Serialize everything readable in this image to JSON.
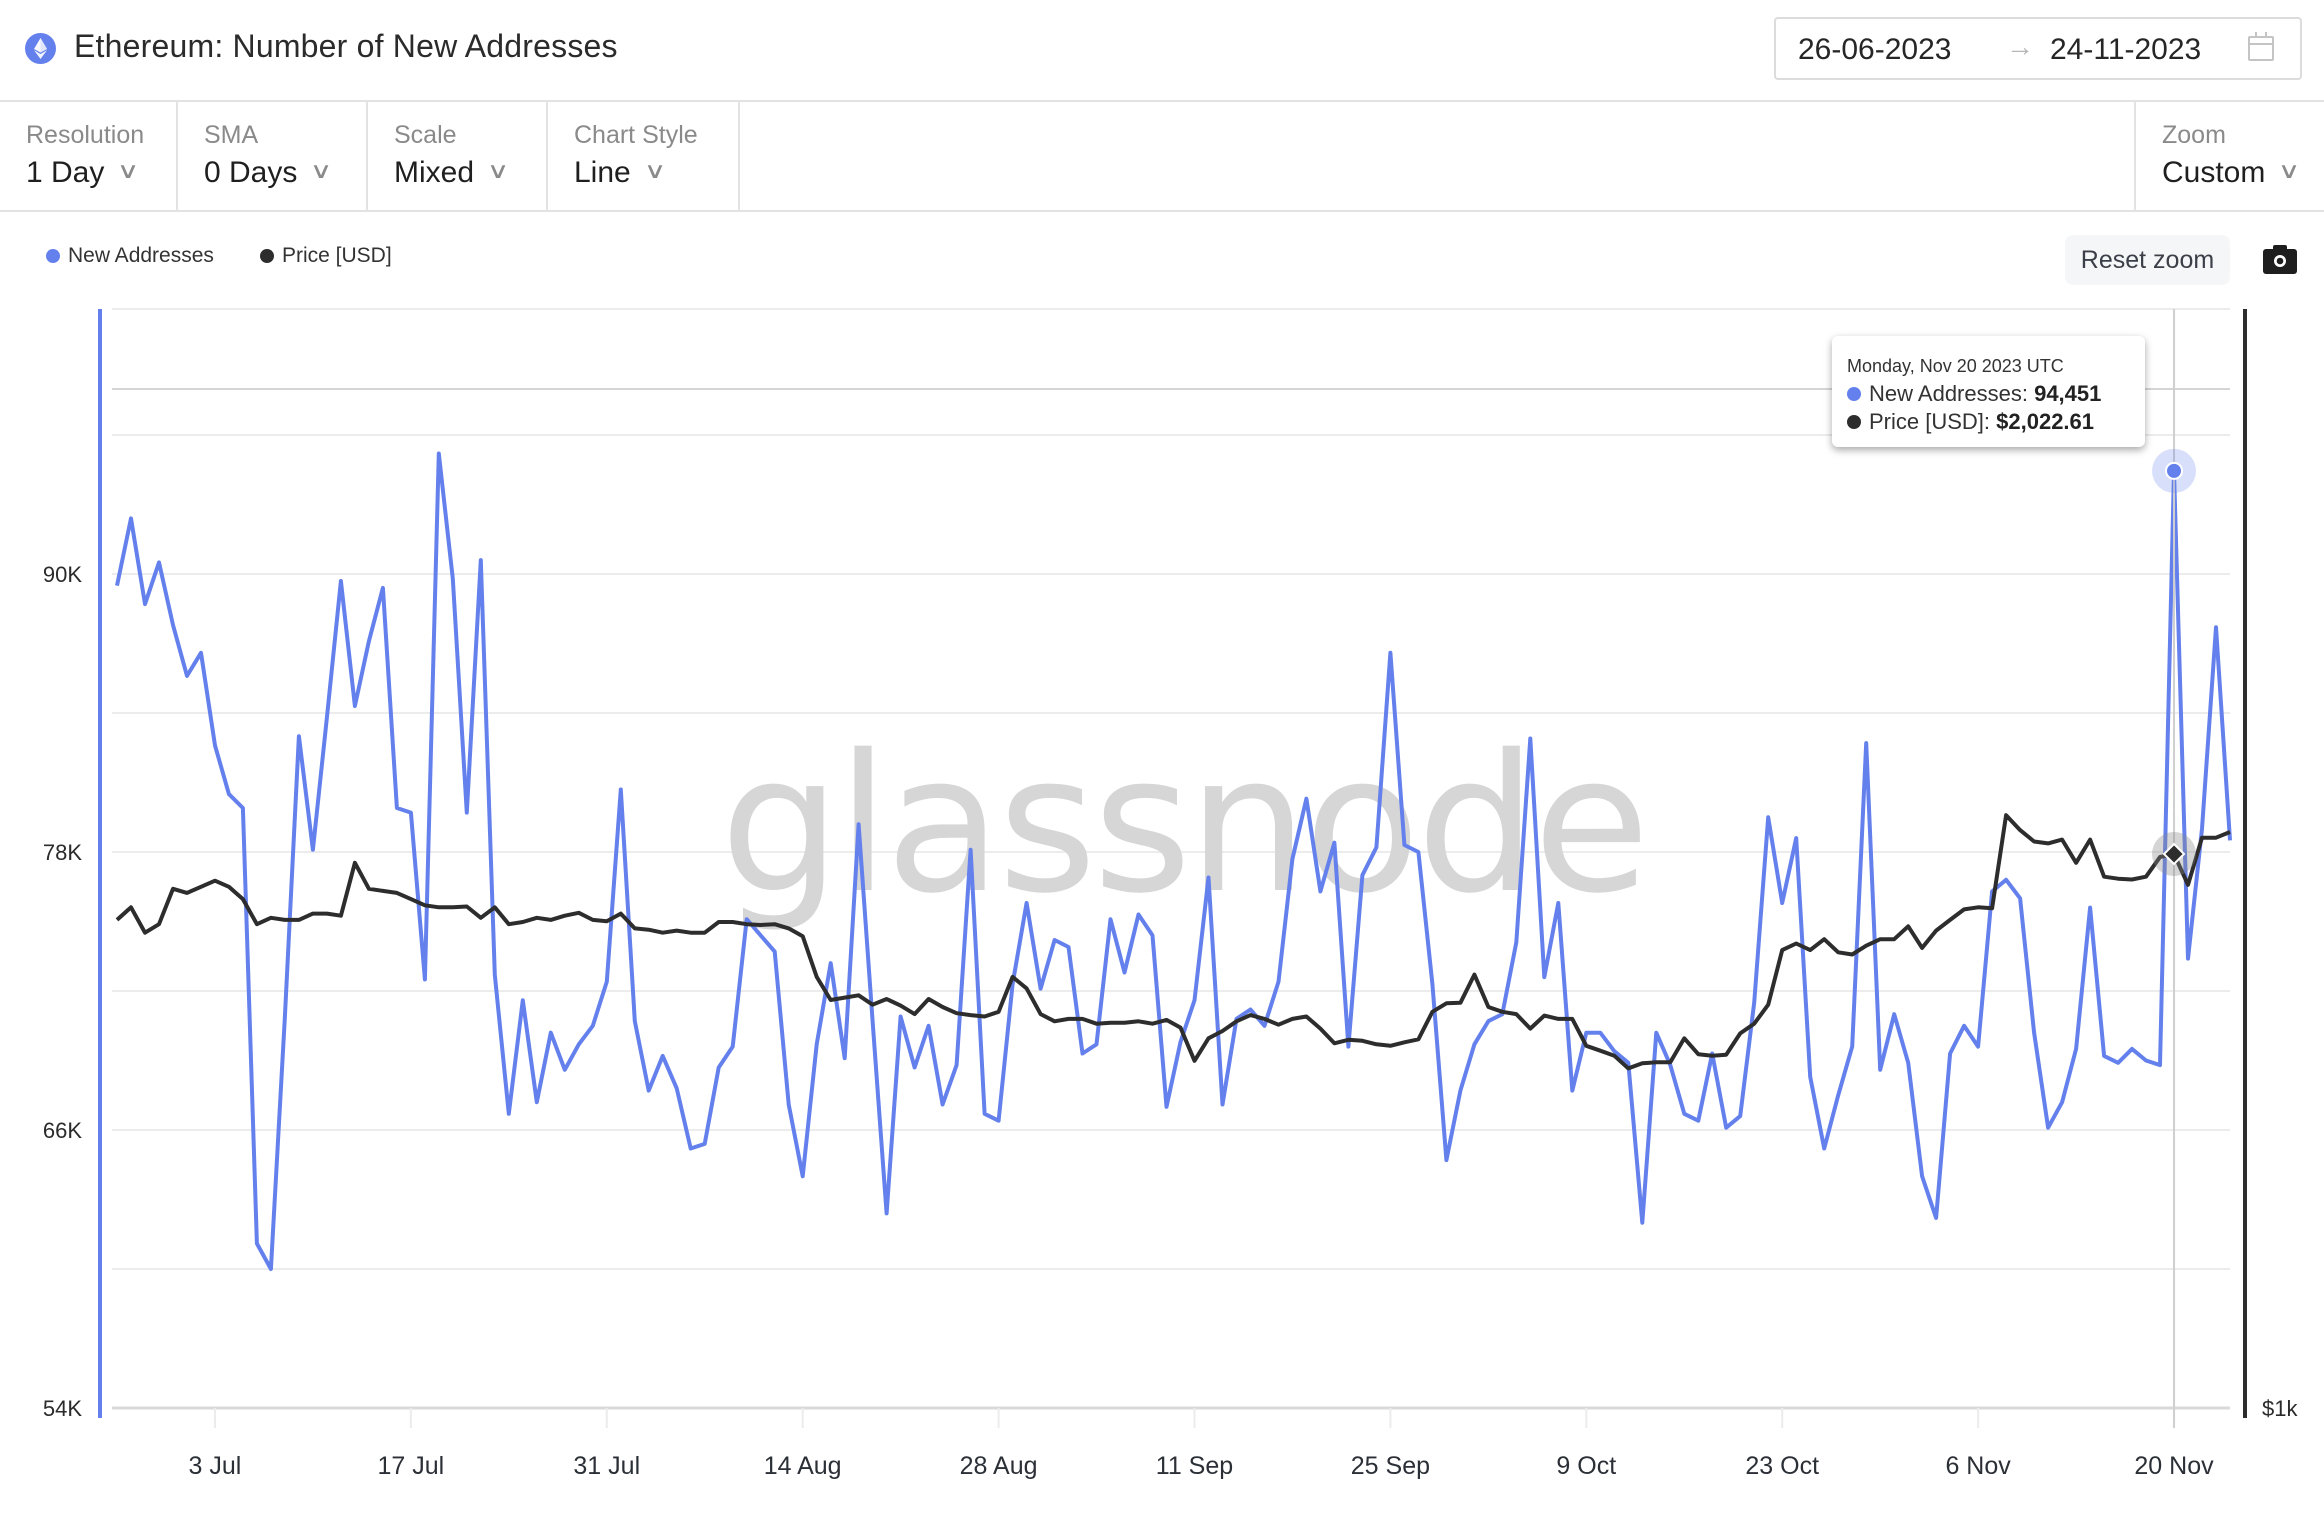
{
  "header": {
    "title": "Ethereum: Number of New Addresses",
    "asset_icon": "ethereum-icon",
    "date_start": "26-06-2023",
    "date_arrow": "→",
    "date_end": "24-11-2023",
    "calendar_icon": "calendar-icon"
  },
  "toolbar": {
    "resolution": {
      "label": "Resolution",
      "value": "1 Day"
    },
    "sma": {
      "label": "SMA",
      "value": "0 Days"
    },
    "scale": {
      "label": "Scale",
      "value": "Mixed"
    },
    "chart_style": {
      "label": "Chart Style",
      "value": "Line"
    },
    "zoom": {
      "label": "Zoom",
      "value": "Custom"
    },
    "chevron": "∨"
  },
  "controls": {
    "reset_zoom_label": "Reset zoom",
    "screenshot_icon": "camera-icon"
  },
  "colors": {
    "new_addresses": "#6480ec",
    "price": "#2d2d2d",
    "grid": "#ececec",
    "watermark": "#d6d6d6"
  },
  "watermark": "glassnode",
  "tooltip": {
    "date": "Monday, Nov 20 2023 UTC",
    "rows": [
      {
        "label": "New Addresses: ",
        "value": "94,451"
      },
      {
        "label": "Price [USD]: ",
        "value": "$2,022.61"
      }
    ]
  },
  "chart_data": {
    "type": "line",
    "title": "Ethereum: Number of New Addresses",
    "x_start": "2023-06-26",
    "x_end": "2023-11-24",
    "x_ticks": [
      "3 Jul",
      "17 Jul",
      "31 Jul",
      "14 Aug",
      "28 Aug",
      "11 Sep",
      "25 Sep",
      "9 Oct",
      "23 Oct",
      "6 Nov",
      "20 Nov"
    ],
    "x_tick_dates": [
      "2023-07-03",
      "2023-07-17",
      "2023-07-31",
      "2023-08-14",
      "2023-08-28",
      "2023-09-11",
      "2023-09-25",
      "2023-10-09",
      "2023-10-23",
      "2023-11-06",
      "2023-11-20"
    ],
    "legend": [
      "New Addresses",
      "Price [USD]"
    ],
    "legend_position": "top-left",
    "grid": true,
    "y_left": {
      "label": "New Addresses",
      "ticks": [
        "54K",
        "66K",
        "78K",
        "90K"
      ],
      "tick_values": [
        54000,
        66000,
        78000,
        90000
      ],
      "range": [
        54000,
        102000
      ],
      "scale": "linear"
    },
    "y_right": {
      "label": "Price [USD]",
      "ticks": [
        "$1k"
      ],
      "tick_values": [
        1000
      ],
      "scale": "log",
      "range": [
        1000,
        3150
      ]
    },
    "highlight": {
      "date": "2023-11-20",
      "new_addresses": 94451,
      "price": 2022.61
    },
    "series": [
      {
        "name": "New Addresses",
        "axis": "left",
        "unit": "thousands",
        "values": [
          89.5,
          92.4,
          88.7,
          90.5,
          87.8,
          85.6,
          86.6,
          82.6,
          80.5,
          79.9,
          61.1,
          60.0,
          70.9,
          83.0,
          78.1,
          83.8,
          89.7,
          84.3,
          87.1,
          89.4,
          79.9,
          79.7,
          72.5,
          95.2,
          89.8,
          79.7,
          90.6,
          72.7,
          66.7,
          71.6,
          67.2,
          70.2,
          68.6,
          69.7,
          70.5,
          72.4,
          80.7,
          70.7,
          67.7,
          69.2,
          67.8,
          65.2,
          65.4,
          68.7,
          69.6,
          75.1,
          74.4,
          73.7,
          67.1,
          64.0,
          69.7,
          73.2,
          69.1,
          79.2,
          70.7,
          62.4,
          70.9,
          68.7,
          70.5,
          67.1,
          68.8,
          78.1,
          66.7,
          66.4,
          72.3,
          75.8,
          72.1,
          74.2,
          73.9,
          69.3,
          69.7,
          75.1,
          72.8,
          75.3,
          74.4,
          67.0,
          69.8,
          71.6,
          76.9,
          67.1,
          70.8,
          71.2,
          70.5,
          72.4,
          77.7,
          80.3,
          76.3,
          78.4,
          69.6,
          77.0,
          78.2,
          86.6,
          78.3,
          78.0,
          72.3,
          64.7,
          67.7,
          69.7,
          70.7,
          71.0,
          74.1,
          82.9,
          72.6,
          75.8,
          67.7,
          70.2,
          70.2,
          69.4,
          68.9,
          62.0,
          70.2,
          68.8,
          66.7,
          66.4,
          69.3,
          66.1,
          66.6,
          71.5,
          79.5,
          75.8,
          78.6,
          68.3,
          65.2,
          67.5,
          69.6,
          82.7,
          68.6,
          71.0,
          68.9,
          64.0,
          62.2,
          69.3,
          70.5,
          69.6,
          76.3,
          76.8,
          76.0,
          70.2,
          66.1,
          67.2,
          69.5,
          75.6,
          69.2,
          68.9,
          69.5,
          69.0,
          68.8,
          94.451,
          73.4,
          79.0,
          87.7,
          78.5
        ]
      },
      {
        "name": "Price [USD]",
        "axis": "right",
        "unit": "USD",
        "values": [
          1860,
          1890,
          1830,
          1850,
          1935,
          1925,
          1940,
          1955,
          1940,
          1910,
          1850,
          1865,
          1860,
          1860,
          1875,
          1875,
          1870,
          2000,
          1935,
          1930,
          1925,
          1910,
          1895,
          1890,
          1890,
          1892,
          1865,
          1890,
          1850,
          1855,
          1865,
          1860,
          1870,
          1877,
          1860,
          1857,
          1875,
          1840,
          1837,
          1830,
          1835,
          1830,
          1830,
          1855,
          1855,
          1850,
          1848,
          1850,
          1840,
          1822,
          1730,
          1680,
          1685,
          1690,
          1670,
          1682,
          1668,
          1650,
          1682,
          1665,
          1652,
          1648,
          1645,
          1655,
          1730,
          1705,
          1650,
          1635,
          1640,
          1640,
          1630,
          1632,
          1632,
          1635,
          1630,
          1638,
          1622,
          1555,
          1600,
          1615,
          1635,
          1648,
          1640,
          1628,
          1640,
          1645,
          1620,
          1590,
          1597,
          1595,
          1588,
          1585,
          1592,
          1598,
          1655,
          1673,
          1674,
          1735,
          1665,
          1655,
          1650,
          1620,
          1647,
          1640,
          1640,
          1585,
          1575,
          1565,
          1540,
          1550,
          1552,
          1552,
          1600,
          1568,
          1565,
          1567,
          1610,
          1630,
          1670,
          1790,
          1805,
          1790,
          1815,
          1785,
          1780,
          1800,
          1815,
          1815,
          1845,
          1795,
          1835,
          1860,
          1885,
          1890,
          1888,
          2125,
          2085,
          2055,
          2050,
          2060,
          2000,
          2060,
          1965,
          1960,
          1958,
          1965,
          2015,
          2022.61,
          1945,
          2065,
          2065,
          2080
        ]
      }
    ]
  }
}
